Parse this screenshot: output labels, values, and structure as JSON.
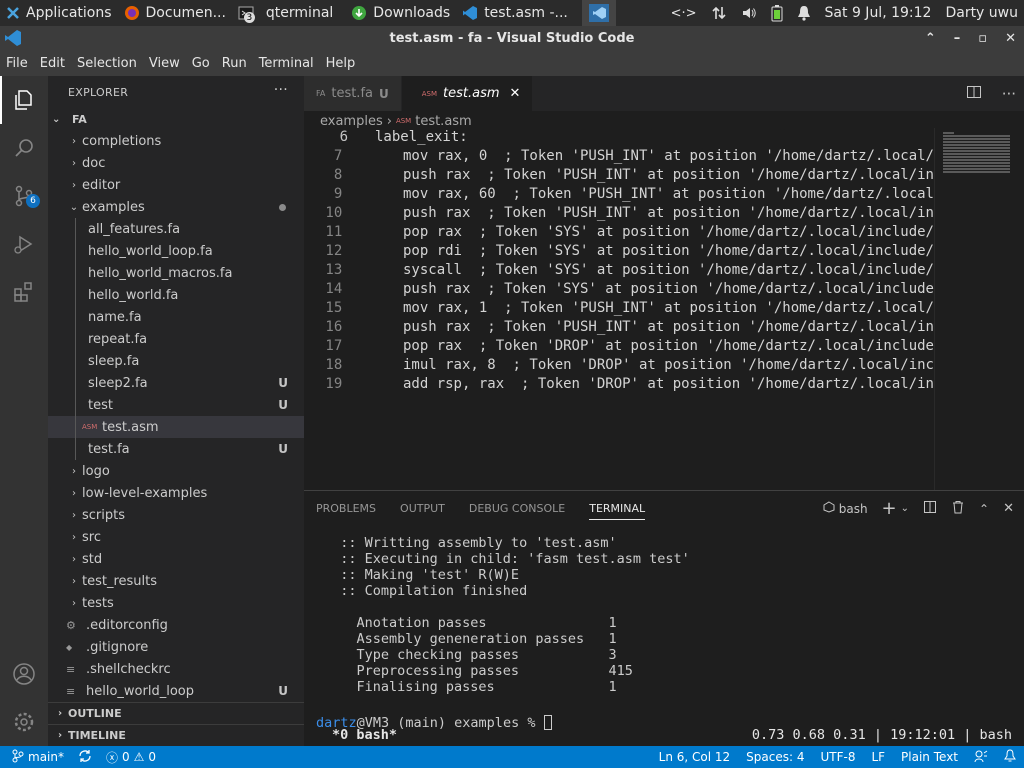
{
  "taskbar": {
    "items": [
      {
        "label": "Applications",
        "icon": "xfce-icon"
      },
      {
        "label": "Documen...",
        "icon": "firefox-icon"
      },
      {
        "label": "qterminal",
        "icon": "terminal-icon",
        "badge": "3"
      },
      {
        "label": "Downloads",
        "icon": "download-icon"
      },
      {
        "label": "test.asm -...",
        "icon": "vscode-icon"
      }
    ],
    "clock": "Sat  9 Jul, 19:12",
    "user": "Darty uwu"
  },
  "window": {
    "title": "test.asm - fa - Visual Studio Code"
  },
  "menu": [
    "File",
    "Edit",
    "Selection",
    "View",
    "Go",
    "Run",
    "Terminal",
    "Help"
  ],
  "activity": {
    "scm_badge": "6"
  },
  "explorer": {
    "header": "EXPLORER",
    "root": "FA",
    "items": [
      {
        "label": "completions",
        "type": "folder"
      },
      {
        "label": "doc",
        "type": "folder"
      },
      {
        "label": "editor",
        "type": "folder"
      },
      {
        "label": "examples",
        "type": "folder-open"
      },
      {
        "label": "all_features.fa",
        "type": "file"
      },
      {
        "label": "hello_world_loop.fa",
        "type": "file"
      },
      {
        "label": "hello_world_macros.fa",
        "type": "file"
      },
      {
        "label": "hello_world.fa",
        "type": "file"
      },
      {
        "label": "name.fa",
        "type": "file"
      },
      {
        "label": "repeat.fa",
        "type": "file"
      },
      {
        "label": "sleep.fa",
        "type": "file"
      },
      {
        "label": "sleep2.fa",
        "type": "file",
        "status": "U"
      },
      {
        "label": "test",
        "type": "file",
        "status": "U"
      },
      {
        "label": "test.asm",
        "type": "file-asm"
      },
      {
        "label": "test.fa",
        "type": "file",
        "status": "U"
      },
      {
        "label": "logo",
        "type": "folder"
      },
      {
        "label": "low-level-examples",
        "type": "folder"
      },
      {
        "label": "scripts",
        "type": "folder"
      },
      {
        "label": "src",
        "type": "folder"
      },
      {
        "label": "std",
        "type": "folder"
      },
      {
        "label": "test_results",
        "type": "folder"
      },
      {
        "label": "tests",
        "type": "folder"
      },
      {
        "label": ".editorconfig",
        "type": "file-gear"
      },
      {
        "label": ".gitignore",
        "type": "file-git"
      },
      {
        "label": ".shellcheckrc",
        "type": "file-lines"
      },
      {
        "label": "hello_world_loop",
        "type": "file-lines",
        "status": "U"
      }
    ],
    "outline": "OUTLINE",
    "timeline": "TIMELINE"
  },
  "tabs": [
    {
      "label": "test.fa",
      "status": "U",
      "icon": "FA"
    },
    {
      "label": "test.asm",
      "icon": "ASM",
      "active": true
    }
  ],
  "breadcrumb": [
    "examples",
    "test.asm"
  ],
  "code": [
    {
      "n": "6",
      "text": "label_exit:"
    },
    {
      "n": "7",
      "text": "    mov rax, 0  ; Token 'PUSH_INT' at position '/home/dartz/.local/"
    },
    {
      "n": "8",
      "text": "    push rax  ; Token 'PUSH_INT' at position '/home/dartz/.local/in"
    },
    {
      "n": "9",
      "text": "    mov rax, 60  ; Token 'PUSH_INT' at position '/home/dartz/.local"
    },
    {
      "n": "10",
      "text": "    push rax  ; Token 'PUSH_INT' at position '/home/dartz/.local/in"
    },
    {
      "n": "11",
      "text": "    pop rax  ; Token 'SYS' at position '/home/dartz/.local/include/"
    },
    {
      "n": "12",
      "text": "    pop rdi  ; Token 'SYS' at position '/home/dartz/.local/include/"
    },
    {
      "n": "13",
      "text": "    syscall  ; Token 'SYS' at position '/home/dartz/.local/include/"
    },
    {
      "n": "14",
      "text": "    push rax  ; Token 'SYS' at position '/home/dartz/.local/include"
    },
    {
      "n": "15",
      "text": "    mov rax, 1  ; Token 'PUSH_INT' at position '/home/dartz/.local/"
    },
    {
      "n": "16",
      "text": "    push rax  ; Token 'PUSH_INT' at position '/home/dartz/.local/in"
    },
    {
      "n": "17",
      "text": "    pop rax  ; Token 'DROP' at position '/home/dartz/.local/include"
    },
    {
      "n": "18",
      "text": "    imul rax, 8  ; Token 'DROP' at position '/home/dartz/.local/inc"
    },
    {
      "n": "19",
      "text": "    add rsp, rax  ; Token 'DROP' at position '/home/dartz/.local/in"
    }
  ],
  "panel": {
    "tabs": [
      "PROBLEMS",
      "OUTPUT",
      "DEBUG CONSOLE",
      "TERMINAL"
    ],
    "shell": "bash",
    "terminal_lines": [
      "  :: Writting assembly to 'test.asm'",
      "  :: Executing in child: 'fasm test.asm test'",
      "  :: Making 'test' R(W)E",
      "  :: Compilation finished",
      "",
      "    Anotation passes               1",
      "    Assembly geneneration passes   1",
      "    Type checking passes           3",
      "    Preprocessing passes           415",
      "    Finalising passes              1",
      ""
    ],
    "prompt_user": "dartz",
    "prompt_rest": "@VM3 (main) examples % ",
    "tmux_left": "*0 bash*",
    "tmux_right": "0.73 0.68 0.31 | 19:12:01 | bash"
  },
  "status": {
    "branch": "main*",
    "errors": "0",
    "warnings": "0",
    "position": "Ln 6, Col 12",
    "spaces": "Spaces: 4",
    "encoding": "UTF-8",
    "eol": "LF",
    "language": "Plain Text"
  },
  "colors": {
    "accent": "#007acc",
    "sidebar": "#252526",
    "editor": "#1e1e1e"
  }
}
